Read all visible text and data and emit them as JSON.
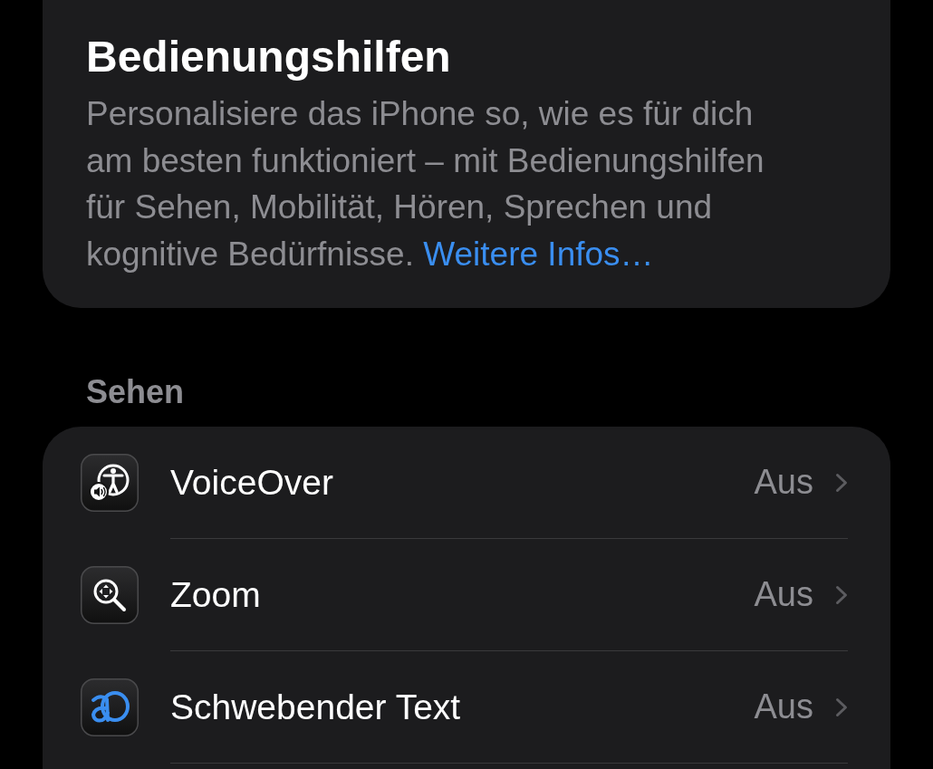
{
  "intro": {
    "title": "Bedienungshilfen",
    "description": "Personalisiere das iPhone so, wie es für dich am besten funktioniert – mit Bedienungshilfen für Sehen, Mobilität, Hören, Sprechen und kognitive Bedürfnisse.",
    "link": "Weitere Infos…"
  },
  "sections": [
    {
      "header": "Sehen",
      "items": [
        {
          "kind": "voiceover",
          "label": "VoiceOver",
          "value": "Aus"
        },
        {
          "kind": "zoom",
          "label": "Zoom",
          "value": "Aus"
        },
        {
          "kind": "hovertext",
          "label": "Schwebender Text",
          "value": "Aus"
        }
      ]
    }
  ]
}
